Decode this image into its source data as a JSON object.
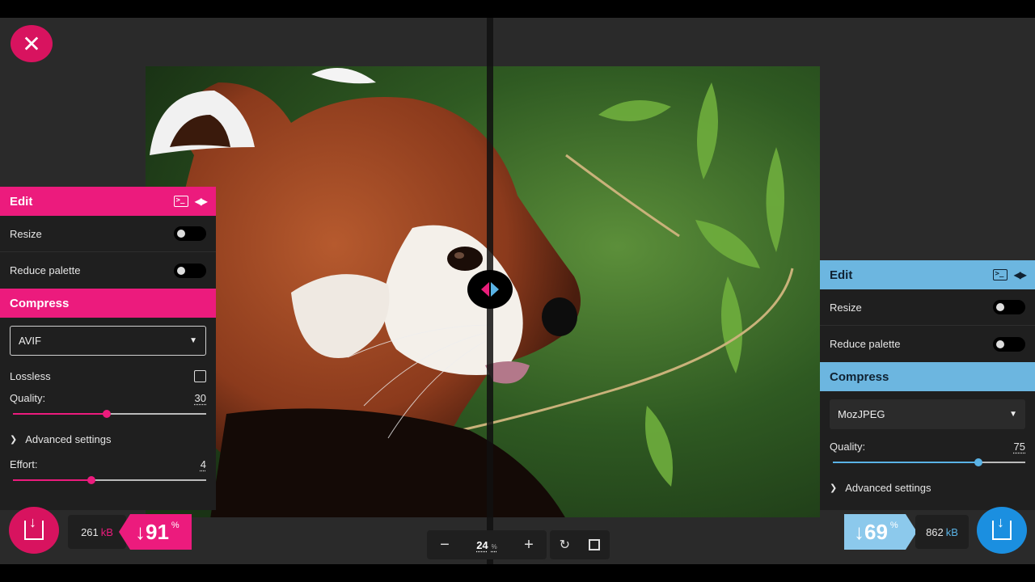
{
  "close_button": {
    "icon": "close-icon",
    "glyph": "✕"
  },
  "left_panel": {
    "accent": "#ec1b7d",
    "edit_title": "Edit",
    "resize_label": "Resize",
    "reduce_palette_label": "Reduce palette",
    "compress_title": "Compress",
    "format_selected": "AVIF",
    "lossless_label": "Lossless",
    "quality_label": "Quality:",
    "quality_value": "30",
    "quality_fraction": 0.48,
    "advanced_label": "Advanced settings",
    "effort_label": "Effort:",
    "effort_value": "4",
    "effort_fraction": 0.4,
    "file_size": "261",
    "file_unit": "kB",
    "reduction_value": "↓91",
    "reduction_unit": "%"
  },
  "right_panel": {
    "accent": "#6cb6e0",
    "edit_title": "Edit",
    "resize_label": "Resize",
    "reduce_palette_label": "Reduce palette",
    "compress_title": "Compress",
    "format_selected": "MozJPEG",
    "quality_label": "Quality:",
    "quality_value": "75",
    "quality_fraction": 0.75,
    "advanced_label": "Advanced settings",
    "file_size": "862",
    "file_unit": "kB",
    "reduction_value": "↓69",
    "reduction_unit": "%"
  },
  "zoom": {
    "value": "24",
    "unit": "%",
    "minus": "−",
    "plus": "+"
  },
  "view_controls": {
    "rotate_glyph": "↻"
  }
}
